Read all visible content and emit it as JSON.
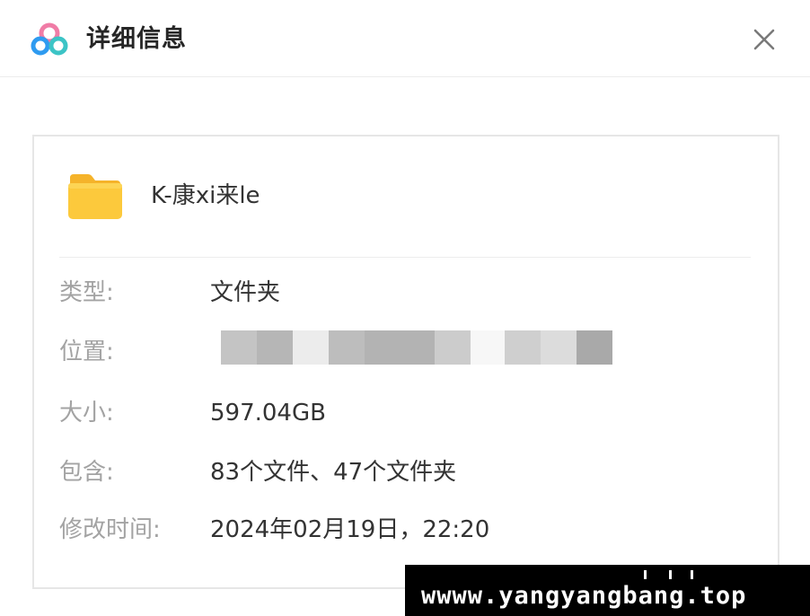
{
  "header": {
    "title": "详细信息",
    "logo_icon": "cloud-logo-icon",
    "close_icon": "close-icon"
  },
  "item": {
    "name": "K-康xi来le",
    "icon": "folder-icon"
  },
  "properties": [
    {
      "label": "类型:",
      "value": "文件夹"
    },
    {
      "label": "位置:",
      "value": ""
    },
    {
      "label": "大小:",
      "value": "597.04GB"
    },
    {
      "label": "包含:",
      "value": "83个文件、47个文件夹"
    },
    {
      "label": "修改时间:",
      "value": "2024年02月19日，22:20"
    }
  ],
  "watermark": {
    "text": "wwww.yangyangbang.top"
  },
  "colors": {
    "folder": "#fcc93c",
    "logo_blue": "#2f9bf0",
    "logo_teal": "#3cc4c6",
    "logo_pink": "#f07ca6",
    "label": "#a3a3a3",
    "value": "#333333"
  }
}
